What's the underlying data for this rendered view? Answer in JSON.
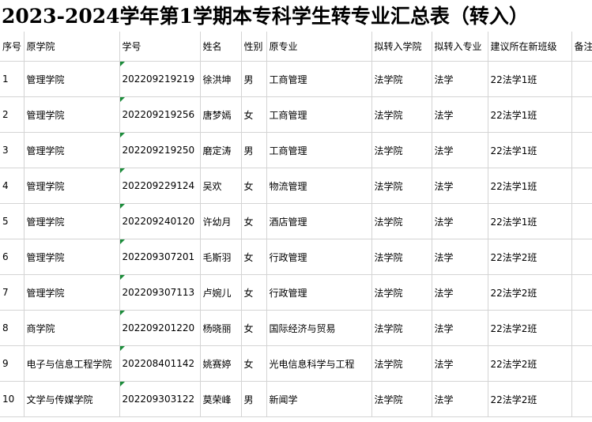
{
  "title": "2023-2024学年第1学期本专科学生转专业汇总表（转入）",
  "headers": [
    "序号",
    "原学院",
    "学号",
    "姓名",
    "性别",
    "原专业",
    "拟转入学院",
    "拟转入专业",
    "建议所在新班级",
    "备注"
  ],
  "rows": [
    [
      "1",
      "管理学院",
      "202209219219",
      "徐洪坤",
      "男",
      "工商管理",
      "法学院",
      "法学",
      "22法学1班",
      ""
    ],
    [
      "2",
      "管理学院",
      "202209219256",
      "唐梦嫣",
      "女",
      "工商管理",
      "法学院",
      "法学",
      "22法学1班",
      ""
    ],
    [
      "3",
      "管理学院",
      "202209219250",
      "磨定涛",
      "男",
      "工商管理",
      "法学院",
      "法学",
      "22法学1班",
      ""
    ],
    [
      "4",
      "管理学院",
      "202209229124",
      "吴欢",
      "女",
      "物流管理",
      "法学院",
      "法学",
      "22法学1班",
      ""
    ],
    [
      "5",
      "管理学院",
      "202209240120",
      "许幼月",
      "女",
      "酒店管理",
      "法学院",
      "法学",
      "22法学1班",
      ""
    ],
    [
      "6",
      "管理学院",
      "202209307201",
      "毛斯羽",
      "女",
      "行政管理",
      "法学院",
      "法学",
      "22法学2班",
      ""
    ],
    [
      "7",
      "管理学院",
      "202209307113",
      "卢婉儿",
      "女",
      "行政管理",
      "法学院",
      "法学",
      "22法学2班",
      ""
    ],
    [
      "8",
      "商学院",
      "202209201220",
      "杨晓丽",
      "女",
      "国际经济与贸易",
      "法学院",
      "法学",
      "22法学2班",
      ""
    ],
    [
      "9",
      "电子与信息工程学院",
      "202208401142",
      "姚赛婷",
      "女",
      "光电信息科学与工程",
      "法学院",
      "法学",
      "22法学2班",
      ""
    ],
    [
      "10",
      "文学与传媒学院",
      "202209303122",
      "莫荣峰",
      "男",
      "新闻学",
      "法学院",
      "法学",
      "22法学2班",
      ""
    ]
  ]
}
